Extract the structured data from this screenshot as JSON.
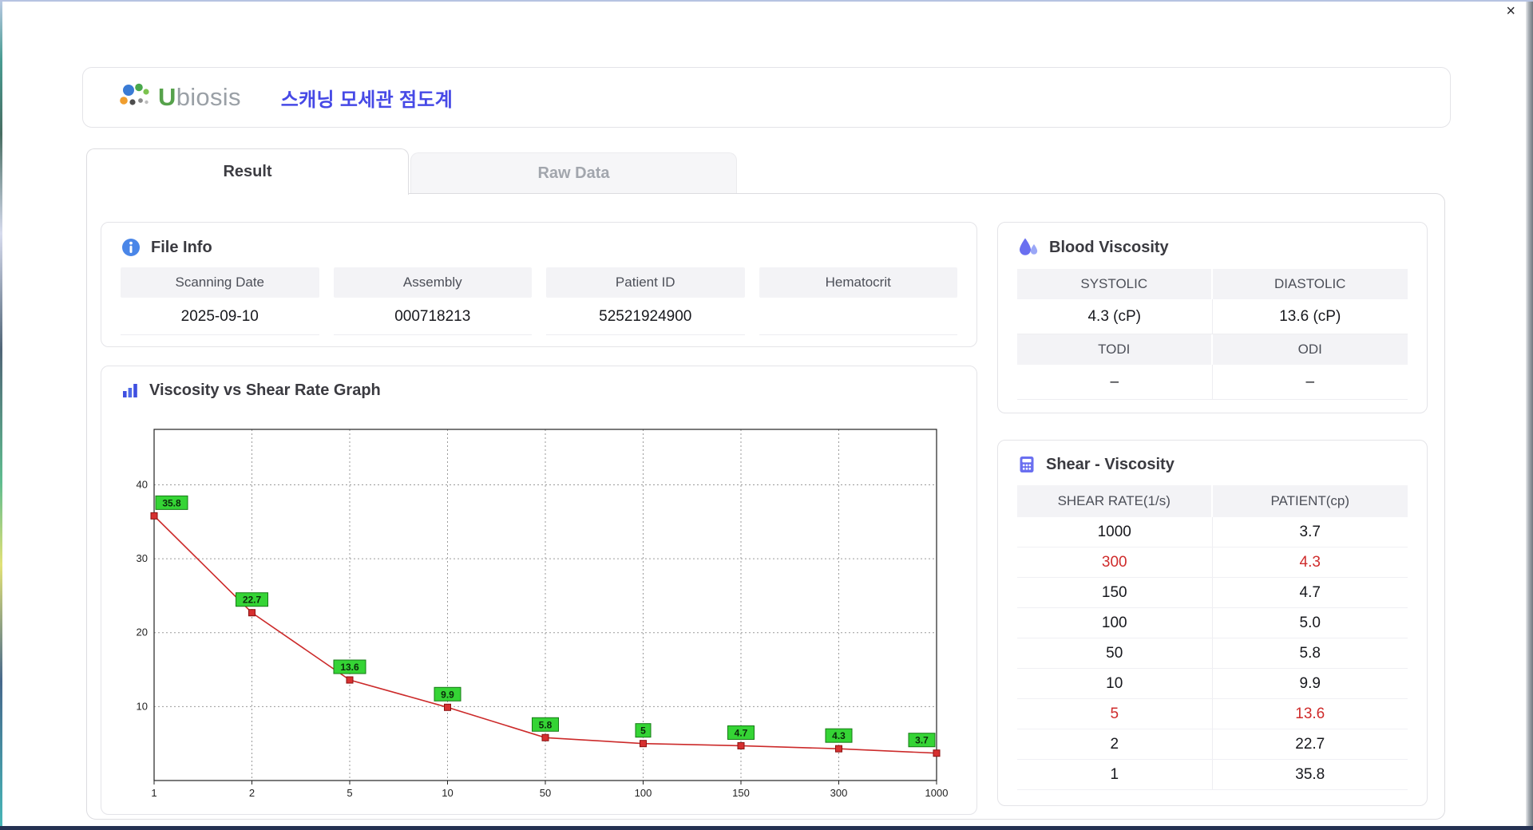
{
  "window": {
    "close_label": "×"
  },
  "header": {
    "logo_text_u": "U",
    "logo_text_rest": "biosis",
    "title": "스캐닝 모세관 점도계"
  },
  "tabs": [
    {
      "label": "Result",
      "active": true
    },
    {
      "label": "Raw Data",
      "active": false
    }
  ],
  "file_info": {
    "title": "File Info",
    "fields": [
      {
        "label": "Scanning Date",
        "value": "2025-09-10"
      },
      {
        "label": "Assembly",
        "value": "000718213"
      },
      {
        "label": "Patient ID",
        "value": "52521924900"
      },
      {
        "label": "Hematocrit",
        "value": ""
      }
    ]
  },
  "blood_viscosity": {
    "title": "Blood Viscosity",
    "groups": [
      {
        "labels": [
          "SYSTOLIC",
          "DIASTOLIC"
        ],
        "values": [
          "4.3 (cP)",
          "13.6 (cP)"
        ]
      },
      {
        "labels": [
          "TODI",
          "ODI"
        ],
        "values": [
          "–",
          "–"
        ]
      }
    ]
  },
  "shear_viscosity": {
    "title": "Shear - Viscosity",
    "headers": [
      "SHEAR RATE(1/s)",
      "PATIENT(cp)"
    ],
    "rows": [
      {
        "shear": "1000",
        "patient": "3.7",
        "highlight": false
      },
      {
        "shear": "300",
        "patient": "4.3",
        "highlight": true
      },
      {
        "shear": "150",
        "patient": "4.7",
        "highlight": false
      },
      {
        "shear": "100",
        "patient": "5.0",
        "highlight": false
      },
      {
        "shear": "50",
        "patient": "5.8",
        "highlight": false
      },
      {
        "shear": "10",
        "patient": "9.9",
        "highlight": false
      },
      {
        "shear": "5",
        "patient": "13.6",
        "highlight": true
      },
      {
        "shear": "2",
        "patient": "22.7",
        "highlight": false
      },
      {
        "shear": "1",
        "patient": "35.8",
        "highlight": false
      }
    ]
  },
  "graph": {
    "title": "Viscosity vs Shear Rate Graph"
  },
  "chart_data": {
    "type": "line",
    "title": "Viscosity vs Shear Rate Graph",
    "x": [
      1,
      2,
      5,
      10,
      50,
      100,
      150,
      300,
      1000
    ],
    "values": [
      35.8,
      22.7,
      13.6,
      9.9,
      5.8,
      5,
      4.7,
      4.3,
      3.7
    ],
    "labels": [
      "35.8",
      "22.7",
      "13.6",
      "9.9",
      "5.8",
      "5",
      "4.7",
      "4.3",
      "3.7"
    ],
    "xlabel": "",
    "ylabel": "",
    "yticks": [
      10,
      20,
      30,
      40
    ],
    "ylim": [
      0,
      47.5
    ],
    "x_scale": "categorical",
    "grid": "dotted",
    "legend": "none",
    "line_color": "#cc2a2a",
    "marker_color": "#d63030",
    "marker_edge": "#8a1111",
    "label_bg": "#35d435",
    "label_edge": "#157a15",
    "label_text": "#0a2a0a"
  },
  "colors": {
    "accent_blue": "#4649e6",
    "highlight_red": "#cf2b2b",
    "header_cell_bg": "#f3f3f6"
  }
}
